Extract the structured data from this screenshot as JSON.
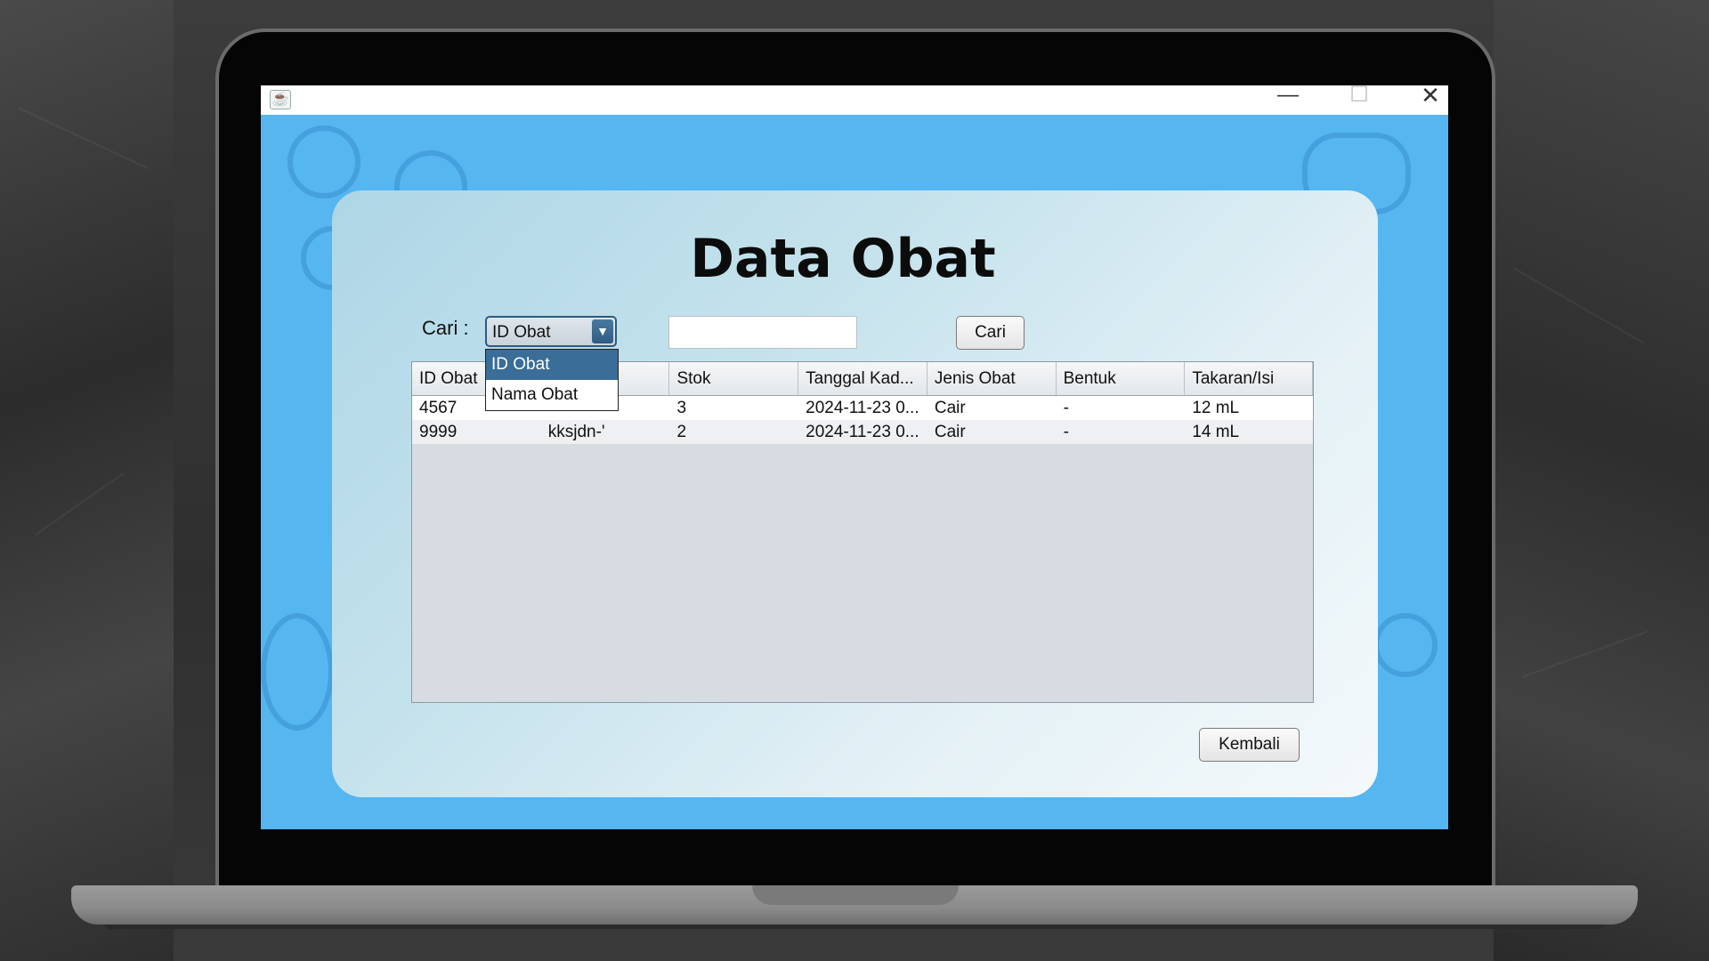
{
  "window": {
    "app_icon": "java-cup-icon",
    "minimize_glyph": "—",
    "maximize_glyph": "☐",
    "close_glyph": "✕"
  },
  "page": {
    "title": "Data Obat",
    "search": {
      "label": "Cari :",
      "selected_option": "ID Obat",
      "options": [
        "ID Obat",
        "Nama Obat"
      ],
      "input_value": "",
      "button_label": "Cari",
      "dropdown_arrow": "▼"
    },
    "table": {
      "columns": [
        "ID Obat",
        "",
        "Stok",
        "Tanggal Kad...",
        "Jenis Obat",
        "Bentuk",
        "Takaran/Isi"
      ],
      "rows": [
        [
          "4567",
          "",
          "3",
          "2024-11-23 0...",
          "Cair",
          "-",
          "12 mL"
        ],
        [
          "9999",
          "kksjdn-'",
          "2",
          "2024-11-23 0...",
          "Cair",
          "-",
          "14 mL"
        ]
      ]
    },
    "back_button_label": "Kembali"
  },
  "colors": {
    "background_blue": "#55b6f0",
    "selection_blue": "#3a6d98"
  }
}
